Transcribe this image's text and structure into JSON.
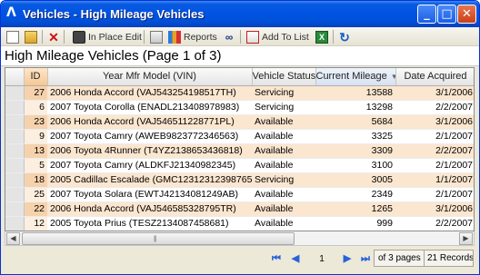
{
  "window": {
    "title": "Vehicles - High Mileage Vehicles",
    "icon": "app-logo-icon",
    "controls": {
      "minimize": "_",
      "maximize": "□",
      "close": "✕"
    }
  },
  "toolbar": {
    "new_icon": "new-document-icon",
    "open_icon": "open-folder-icon",
    "delete_icon": "delete-x-icon",
    "in_place_edit_label": "In Place Edit",
    "reports_label": "Reports",
    "find_icon": "binoculars-icon",
    "add_to_list_label": "Add To List",
    "export_icon": "excel-export-icon",
    "refresh_icon": "refresh-icon"
  },
  "heading": {
    "title": "High Mileage Vehicles (Page 1 of 3)"
  },
  "grid": {
    "columns": [
      "ID",
      "Year Mfr Model (VIN)",
      "Vehicle Status",
      "Current Mileage",
      "Date Acquired"
    ],
    "sorted_column": "Current Mileage",
    "sort_direction": "descending",
    "rows": [
      {
        "id": "27",
        "vehicle": "2006 Honda Accord (VAJ543254198517TH)",
        "status": "Servicing",
        "mileage": "13588",
        "date": "3/1/2006"
      },
      {
        "id": "6",
        "vehicle": "2007 Toyota Corolla (ENADL213408978983)",
        "status": "Servicing",
        "mileage": "13298",
        "date": "2/2/2007"
      },
      {
        "id": "23",
        "vehicle": "2006 Honda Accord (VAJ546511228771PL)",
        "status": "Available",
        "mileage": "5684",
        "date": "3/1/2006"
      },
      {
        "id": "9",
        "vehicle": "2007 Toyota Camry (AWEB9823772346563)",
        "status": "Available",
        "mileage": "3325",
        "date": "2/1/2007"
      },
      {
        "id": "13",
        "vehicle": "2006 Toyota 4Runner (T4YZ2138653436818)",
        "status": "Available",
        "mileage": "3309",
        "date": "2/2/2007"
      },
      {
        "id": "5",
        "vehicle": "2007 Toyota Camry (ALDKFJ21340982345)",
        "status": "Available",
        "mileage": "3100",
        "date": "2/1/2007"
      },
      {
        "id": "18",
        "vehicle": "2005 Cadillac Escalade (GMC12312312398765)",
        "status": "Servicing",
        "mileage": "3005",
        "date": "1/1/2007"
      },
      {
        "id": "25",
        "vehicle": "2007 Toyota Solara (EWTJ42134081249AB)",
        "status": "Available",
        "mileage": "2349",
        "date": "2/1/2007"
      },
      {
        "id": "22",
        "vehicle": "2006 Honda Accord (VAJ546585328795TR)",
        "status": "Available",
        "mileage": "1265",
        "date": "3/1/2006"
      },
      {
        "id": "12",
        "vehicle": "2005 Toyota Prius (TESZ2134087458681)",
        "status": "Available",
        "mileage": "999",
        "date": "2/2/2007"
      }
    ]
  },
  "pager": {
    "current_page": "1",
    "of_pages": "of 3 pages",
    "records": "21 Records"
  }
}
